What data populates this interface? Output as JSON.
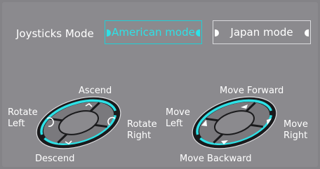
{
  "header": {
    "label": "Joysticks Mode",
    "modes": [
      {
        "label": "American mode",
        "selected": true
      },
      {
        "label": "Japan mode",
        "selected": false
      }
    ]
  },
  "left_pad": {
    "top": "Ascend",
    "bottom": "Descend",
    "left_line1": "Rotate",
    "left_line2": "Left",
    "right_line1": "Rotate",
    "right_line2": "Right"
  },
  "right_pad": {
    "top": "Move Forward",
    "bottom": "Move Backward",
    "left_line1": "Move",
    "left_line2": "Left",
    "right_line1": "Move",
    "right_line2": "Right"
  },
  "colors": {
    "accent": "#2ee1e6",
    "background": "#8b8a8e",
    "pad_dark": "#1a1a1c",
    "pad_segment": "#7a797d"
  }
}
